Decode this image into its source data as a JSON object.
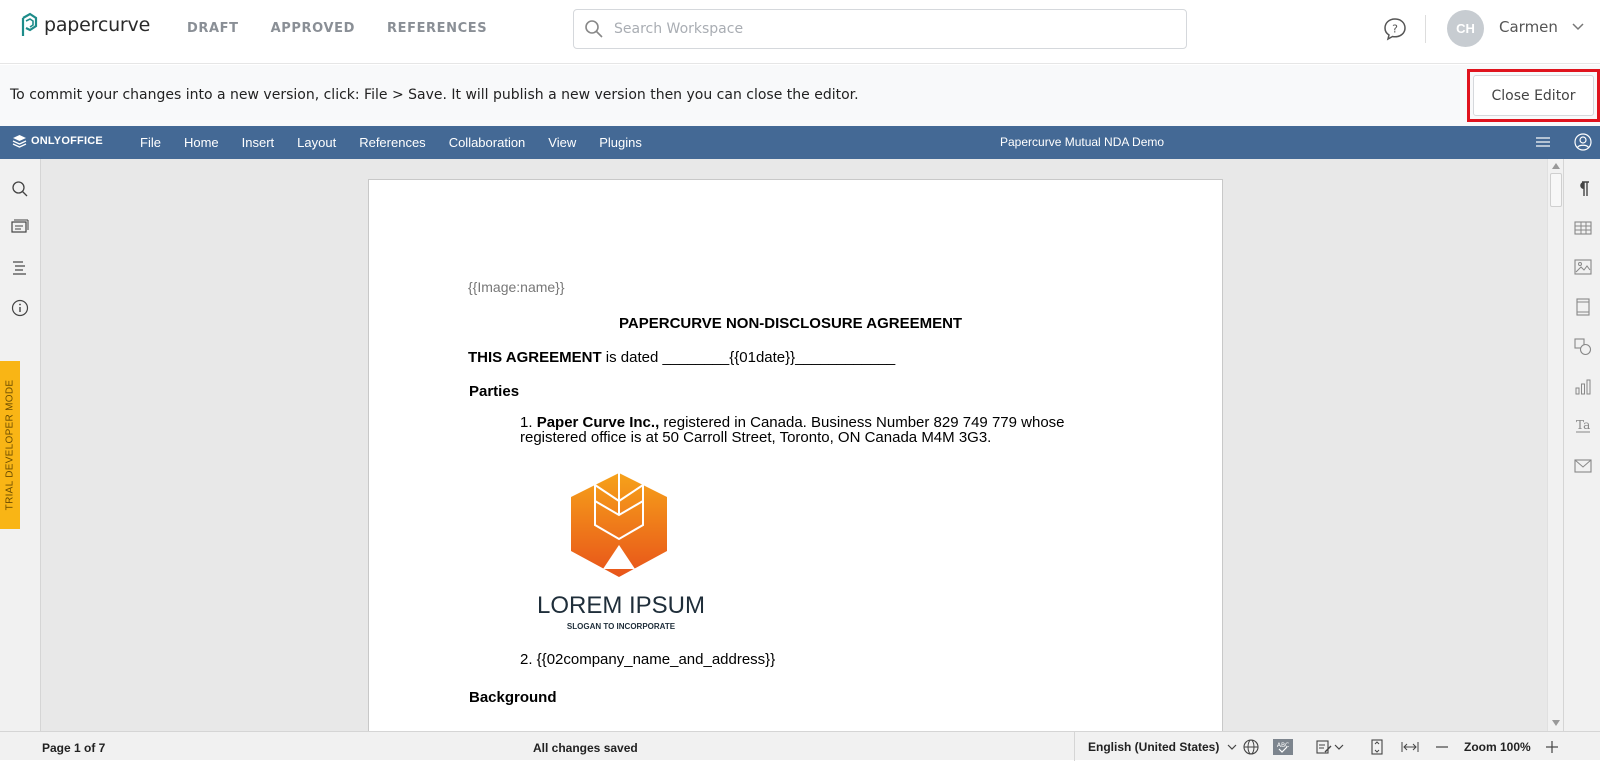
{
  "app": {
    "logo_text": "papercurve",
    "nav": [
      "DRAFT",
      "APPROVED",
      "REFERENCES"
    ],
    "search_placeholder": "Search Workspace",
    "user_initials": "CH",
    "user_name": "Carmen"
  },
  "infobar": {
    "message": "To commit your changes into a new version, click: File > Save. It will publish a new version then you can close the editor.",
    "close_label": "Close Editor"
  },
  "editor": {
    "brand": "ONLYOFFICE",
    "menu": [
      "File",
      "Home",
      "Insert",
      "Layout",
      "References",
      "Collaboration",
      "View",
      "Plugins"
    ],
    "doc_name": "Papercurve Mutual NDA Demo",
    "trial_label": "TRIAL DEVELOPER MODE"
  },
  "document": {
    "image_placeholder": "{{Image:name}}",
    "title": "PAPERCURVE NON-DISCLOSURE AGREEMENT",
    "agreement_bold": "THIS AGREEMENT",
    "agreement_rest": " is dated ________{{01date}}____________",
    "parties_heading": "Parties",
    "party1_num": "1. ",
    "party1_bold": "Paper Curve Inc.,",
    "party1_rest": " registered in Canada. Business Number 829 749 779 whose",
    "party1_line2": "registered office is at 50 Carroll Street, Toronto, ON Canada M4M 3G3.",
    "logo_name": "LOREM IPSUM",
    "logo_slogan": "SLOGAN TO INCORPORATE",
    "party2": "2. {{02company_name_and_address}}",
    "background_heading": "Background"
  },
  "statusbar": {
    "page": "Page 1 of 7",
    "saved": "All changes saved",
    "language": "English (United States)",
    "zoom": "Zoom 100%"
  },
  "colors": {
    "oo_bar": "#446995",
    "trial": "#f9b515",
    "highlight": "#e0141e"
  }
}
